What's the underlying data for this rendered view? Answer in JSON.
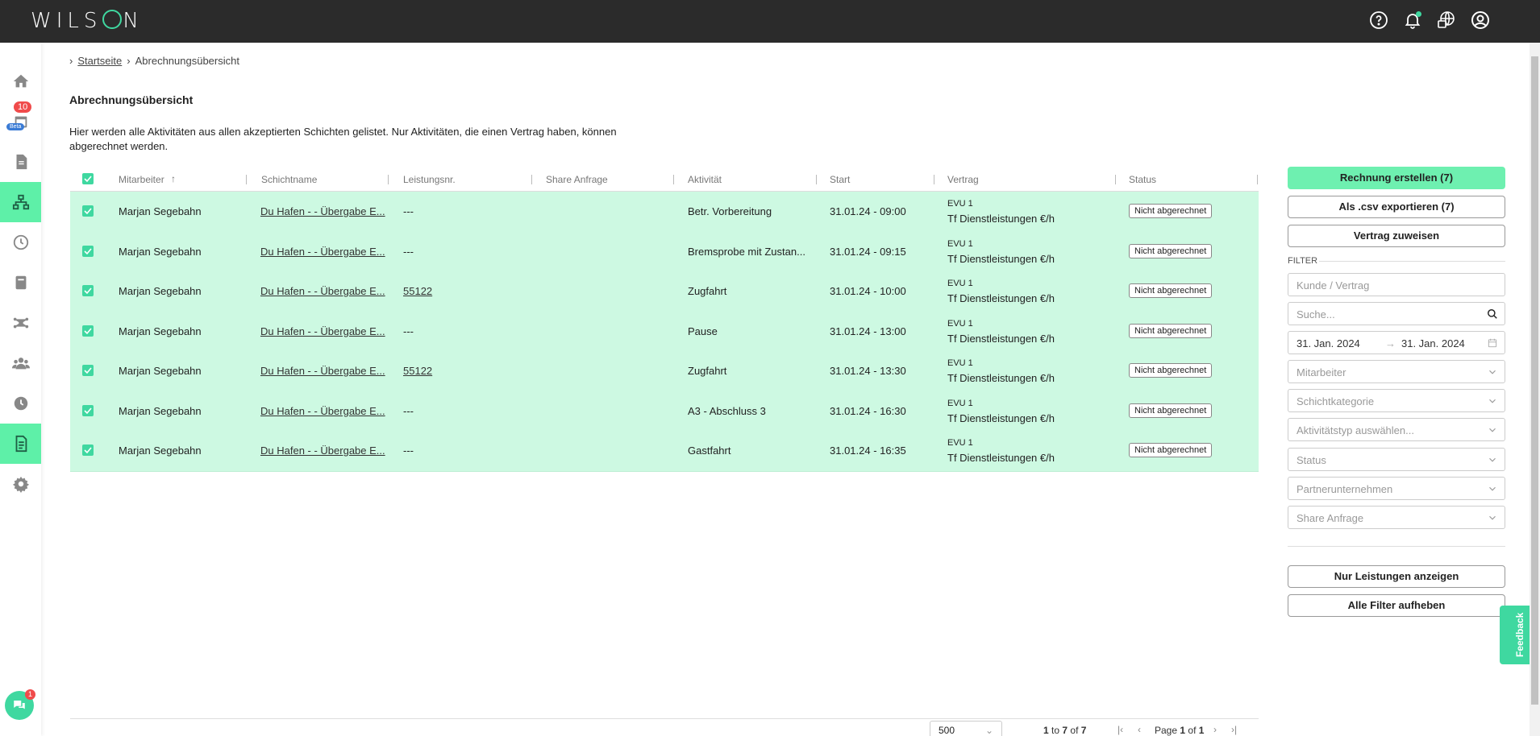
{
  "app": {
    "logo": "WILSON"
  },
  "topbar": {
    "icons": [
      "help-icon",
      "bell-icon",
      "language-icon",
      "user-icon"
    ]
  },
  "sidenav": {
    "badge_count": "10",
    "beta_label": "Beta",
    "chat_badge": "1",
    "items": [
      "home-icon",
      "calendar-icon",
      "document-icon",
      "network-icon",
      "clock-icon",
      "book-icon",
      "share-icon",
      "team-icon",
      "history-icon",
      "invoice-icon",
      "settings-icon"
    ]
  },
  "breadcrumb": {
    "home": "Startseite",
    "current": "Abrechnungsübersicht"
  },
  "page": {
    "title": "Abrechnungsübersicht",
    "description": "Hier werden alle Aktivitäten aus allen akzeptierten Schichten gelistet. Nur Aktivitäten, die einen Vertrag haben, können abgerechnet werden."
  },
  "table": {
    "columns": [
      "Mitarbeiter",
      "Schichtname",
      "Leistungsnr.",
      "Share Anfrage",
      "Aktivität",
      "Start",
      "Vertrag",
      "Status"
    ],
    "rows": [
      {
        "employee": "Marjan Segebahn",
        "shift": "Du Hafen - - Übergabe E...",
        "service": "---",
        "activity": "Betr. Vorbereitung",
        "start": "31.01.24 - 09:00",
        "contract1": "EVU 1",
        "contract2": "Tf Dienstleistungen €/h",
        "status": "Nicht abgerechnet"
      },
      {
        "employee": "Marjan Segebahn",
        "shift": "Du Hafen - - Übergabe E...",
        "service": "---",
        "activity": "Bremsprobe mit Zustan...",
        "start": "31.01.24 - 09:15",
        "contract1": "EVU 1",
        "contract2": "Tf Dienstleistungen €/h",
        "status": "Nicht abgerechnet"
      },
      {
        "employee": "Marjan Segebahn",
        "shift": "Du Hafen - - Übergabe E...",
        "service": "55122",
        "activity": "Zugfahrt",
        "start": "31.01.24 - 10:00",
        "contract1": "EVU 1",
        "contract2": "Tf Dienstleistungen €/h",
        "status": "Nicht abgerechnet"
      },
      {
        "employee": "Marjan Segebahn",
        "shift": "Du Hafen - - Übergabe E...",
        "service": "---",
        "activity": "Pause",
        "start": "31.01.24 - 13:00",
        "contract1": "EVU 1",
        "contract2": "Tf Dienstleistungen €/h",
        "status": "Nicht abgerechnet"
      },
      {
        "employee": "Marjan Segebahn",
        "shift": "Du Hafen - - Übergabe E...",
        "service": "55122",
        "activity": "Zugfahrt",
        "start": "31.01.24 - 13:30",
        "contract1": "EVU 1",
        "contract2": "Tf Dienstleistungen €/h",
        "status": "Nicht abgerechnet"
      },
      {
        "employee": "Marjan Segebahn",
        "shift": "Du Hafen - - Übergabe E...",
        "service": "---",
        "activity": "A3 - Abschluss 3",
        "start": "31.01.24 - 16:30",
        "contract1": "EVU 1",
        "contract2": "Tf Dienstleistungen €/h",
        "status": "Nicht abgerechnet"
      },
      {
        "employee": "Marjan Segebahn",
        "shift": "Du Hafen - - Übergabe E...",
        "service": "---",
        "activity": "Gastfahrt",
        "start": "31.01.24 - 16:35",
        "contract1": "EVU 1",
        "contract2": "Tf Dienstleistungen €/h",
        "status": "Nicht abgerechnet"
      }
    ]
  },
  "right_panel": {
    "create_invoice": "Rechnung erstellen (7)",
    "export_csv": "Als .csv exportieren (7)",
    "assign_contract": "Vertrag zuweisen",
    "filter_heading": "FILTER",
    "customer_placeholder": "Kunde / Vertrag",
    "search_placeholder": "Suche...",
    "date_from": "31. Jan. 2024",
    "date_to": "31. Jan. 2024",
    "date_separator": "→",
    "employee_filter": "Mitarbeiter",
    "shift_category": "Schichtkategorie",
    "activity_type": "Aktivitätstyp auswählen...",
    "status_filter": "Status",
    "partner": "Partnerunternehmen",
    "share_request": "Share Anfrage",
    "only_services": "Nur Leistungen anzeigen",
    "clear_filters": "Alle Filter aufheben"
  },
  "feedback": {
    "label": "Feedback"
  },
  "pager": {
    "page_size": "500",
    "range_start": "1",
    "range_to": "to",
    "range_end": "7",
    "range_of": "of",
    "total": "7",
    "page_label": "Page",
    "page_current": "1",
    "page_of": "of",
    "page_total": "1"
  },
  "colors": {
    "accent": "#3fd8a0",
    "row_selected": "#cdf9e2",
    "primary_button": "#6ef0b0",
    "topbar": "#2b2b2b"
  }
}
